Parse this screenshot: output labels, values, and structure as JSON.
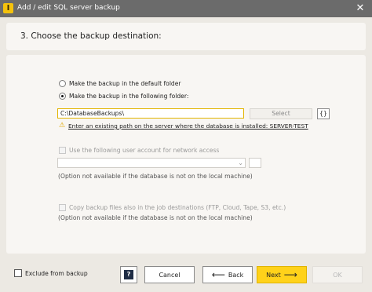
{
  "window": {
    "title": "Add / edit SQL server backup",
    "icon": "app-logo-icon",
    "icon_glyph": "I",
    "close_glyph": "✕"
  },
  "step": {
    "title": "3. Choose the backup destination:"
  },
  "destination": {
    "option_default": "Make the backup in the default folder",
    "option_following": "Make the backup in the following folder:",
    "selected": "option_following",
    "path_value": "C:\\DatabaseBackups\\",
    "select_label": "Select",
    "vars_label": "{}",
    "warning_icon": "warning-icon",
    "warning_glyph": "⚠",
    "warning_text": "Enter an existing path on the server where the database is installed: SERVER-TEST"
  },
  "network": {
    "checkbox_label": "Use the following user account for network access",
    "note": "(Option not available if the database is not on the local machine)",
    "combo_arrow": "⌄"
  },
  "copy": {
    "checkbox_label": "Copy backup files also in the job destinations (FTP, Cloud, Tape, S3, etc.)",
    "note": "(Option not available if the database is not on the local machine)"
  },
  "footer": {
    "exclude_label": "Exclude from backup",
    "help_glyph": "?",
    "cancel_label": "Cancel",
    "back_label": "Back",
    "back_arrow": "⟵",
    "next_label": "Next",
    "next_arrow": "⟶",
    "ok_label": "OK"
  },
  "colors": {
    "titlebar": "#6b6b6b",
    "accent": "#ffd21a",
    "warning": "#e0a800",
    "panel": "#f8f6f3",
    "background": "#ece9e3"
  }
}
